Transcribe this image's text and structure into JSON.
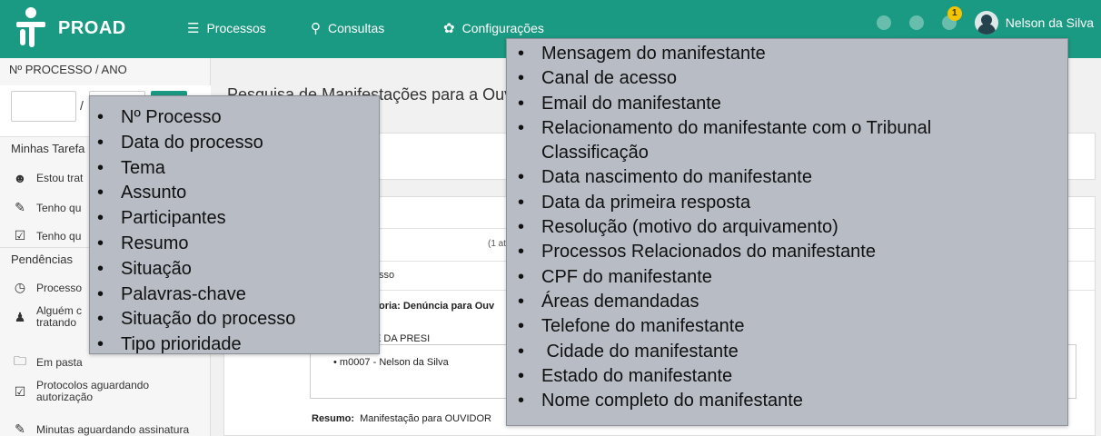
{
  "navbar": {
    "logo_text": "PROAD",
    "items": [
      {
        "label": "Processos",
        "icon": "menu-icon"
      },
      {
        "label": "Consultas",
        "icon": "search-icon"
      },
      {
        "label": "Configurações",
        "icon": "gear-icon"
      }
    ],
    "notification_count": "1",
    "user_name": "Nelson da Silva"
  },
  "sidebar": {
    "process_label": "Nº PROCESSO / ANO",
    "slash": "/",
    "section_tasks": "Minhas Tarefa",
    "tasks": [
      {
        "label": "Estou trat",
        "icon": "user-icon"
      },
      {
        "label": "Tenho qu",
        "icon": "edit-icon"
      },
      {
        "label": "Tenho qu",
        "icon": "checkbox-icon"
      }
    ],
    "section_pending": "Pendências",
    "pending": [
      {
        "label": "Processo",
        "icon": "clock-icon"
      },
      {
        "label": "Alguém c",
        "label2": "tratando",
        "icon": "group-icon"
      },
      {
        "label": "Em pasta",
        "icon": "folder-icon"
      },
      {
        "label": "Protocolos aguardando",
        "label2": "autorização",
        "icon": "checkbox-icon"
      },
      {
        "label": "Minutas aguardando assinatura",
        "icon": "edit-icon"
      }
    ]
  },
  "main": {
    "page_title": "Pesquisa de Manifestações para a Ouv",
    "range_text": "(1 at",
    "column_header": "sso",
    "category": "oria: Denúncia para Ouv",
    "participant_1": "- GABINETE DA PRESI",
    "participant_2": "• m0007 - Nelson da Silva",
    "resumo_label": "Resumo:",
    "resumo_text": "Manifestação para OUVIDOR"
  },
  "popup_left": {
    "items": [
      "Nº Processo",
      "Data do processo",
      "Tema",
      "Assunto",
      "Participantes",
      "Resumo",
      "Situação",
      "Palavras-chave",
      "Situação do processo",
      "Tipo prioridade"
    ]
  },
  "popup_right": {
    "items": [
      {
        "text": "Mensagem do manifestante",
        "bullet": true
      },
      {
        "text": "Canal de acesso",
        "bullet": true
      },
      {
        "text": "Email do manifestante",
        "bullet": true
      },
      {
        "text": "Relacionamento do manifestante com o Tribunal",
        "bullet": true
      },
      {
        "text": "Classificação",
        "bullet": false
      },
      {
        "text": "Data nascimento do manifestante",
        "bullet": true
      },
      {
        "text": "Data da primeira resposta",
        "bullet": true
      },
      {
        "text": "Resolução (motivo do arquivamento)",
        "bullet": true
      },
      {
        "text": "Processos Relacionados do manifestante",
        "bullet": true
      },
      {
        "text": "CPF do manifestante",
        "bullet": true
      },
      {
        "text": "Áreas demandadas",
        "bullet": true
      },
      {
        "text": "Telefone do manifestante",
        "bullet": true
      },
      {
        "text": " Cidade do manifestante",
        "bullet": true
      },
      {
        "text": "Estado do manifestante",
        "bullet": true
      },
      {
        "text": "Nome completo do manifestante",
        "bullet": true
      }
    ]
  },
  "colors": {
    "brand": "#1a9a82",
    "popup_bg": "#b7bcc5",
    "badge": "#f5c400"
  }
}
